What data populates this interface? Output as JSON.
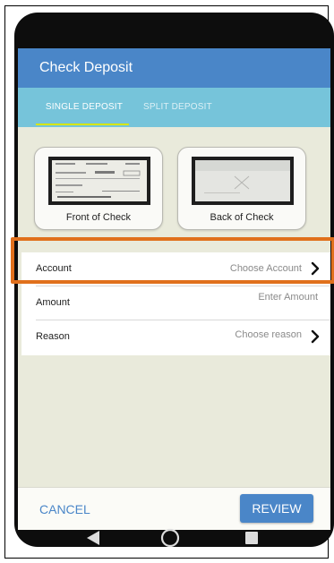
{
  "app": {
    "title": "Check Deposit"
  },
  "tabs": [
    {
      "label": "SINGLE DEPOSIT",
      "active": true
    },
    {
      "label": "SPLIT DEPOSIT",
      "active": false
    }
  ],
  "checks": {
    "front_label": "Front of Check",
    "back_label": "Back of Check"
  },
  "form": {
    "rows": [
      {
        "label": "Account",
        "value": "Choose Account",
        "has_chevron": true
      },
      {
        "label": "Amount",
        "value": "Enter Amount",
        "has_chevron": false
      },
      {
        "label": "Reason",
        "value": "Choose reason",
        "has_chevron": true
      }
    ]
  },
  "actions": {
    "cancel_label": "CANCEL",
    "review_label": "REVIEW"
  },
  "nav_bar": {
    "icons": [
      "back-icon",
      "home-icon",
      "recents-icon"
    ]
  },
  "colors": {
    "app_bar": "#4a86c8",
    "tab_bar": "#76c4da",
    "tab_indicator": "#d7e600",
    "screen_background": "#e9eadb",
    "highlight": "#e0701c"
  }
}
